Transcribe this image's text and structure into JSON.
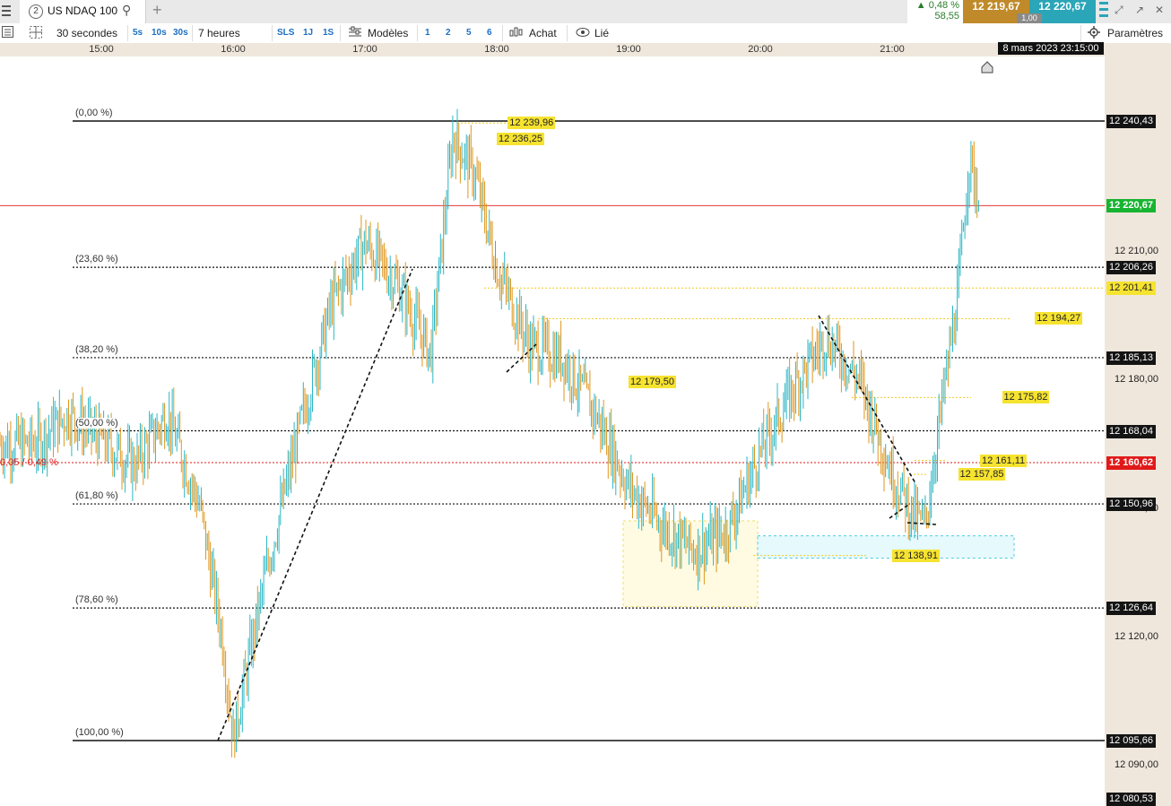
{
  "window": {
    "tab_number": "2",
    "instrument": "US NDAQ 100",
    "quote_change_pct": "0,48 %",
    "quote_change_pts": "58,55",
    "bid": "12 219,67",
    "ask": "12 220,67",
    "quantity": "1,00"
  },
  "toolbar": {
    "interval": "30 secondes",
    "quick_intervals": [
      "5s",
      "10s",
      "30s"
    ],
    "duration": "7 heures",
    "ranges": [
      "SLS",
      "1J",
      "1S"
    ],
    "templates_label": "Modèles",
    "layouts": [
      "1",
      "2",
      "5",
      "6"
    ],
    "buy_label": "Achat",
    "linked_label": "Lié",
    "settings_label": "Paramètres"
  },
  "time_axis": {
    "labels": [
      "15:00",
      "16:00",
      "17:00",
      "18:00",
      "19:00",
      "20:00",
      "21:00"
    ],
    "cursor_date": "8 mars 2023 23:15:00"
  },
  "colors": {
    "up": "#2bb6c4",
    "down": "#e0961c",
    "last_price": "#18b431",
    "alert_red": "#e01a1a",
    "level_yellow": "#f6e330",
    "axis_bg": "#efe7dc"
  },
  "chart_data": {
    "type": "line",
    "style": "candlestick",
    "instrument": "US NDAQ 100",
    "interval": "30s",
    "x_range": [
      "14:30",
      "21:45"
    ],
    "ylim": [
      12080,
      12250
    ],
    "series": [
      {
        "x": [
          "14:30",
          "14:45",
          "15:00",
          "15:15",
          "15:30",
          "15:45",
          "15:55",
          "16:00",
          "16:15",
          "16:30",
          "16:45",
          "17:00",
          "17:15",
          "17:30",
          "17:40",
          "17:50",
          "18:00",
          "18:15",
          "18:30",
          "18:45",
          "19:00",
          "19:15",
          "19:30",
          "19:45",
          "20:00",
          "20:15",
          "20:30",
          "20:45",
          "21:00",
          "21:10",
          "21:15",
          "21:20",
          "21:30",
          "21:35",
          "21:40"
        ],
        "values": [
          12165,
          12172,
          12166,
          12160,
          12172,
          12150,
          12120,
          12096,
          12135,
          12168,
          12198,
          12212,
          12202,
          12186,
          12237,
          12228,
          12206,
          12188,
          12185,
          12172,
          12155,
          12146,
          12140,
          12145,
          12163,
          12178,
          12190,
          12180,
          12158,
          12148,
          12146,
          12165,
          12200,
          12232,
          12221
        ]
      }
    ],
    "fibonacci": [
      {
        "label": "(0,00 %)",
        "price": 12240.43
      },
      {
        "label": "(23,60 %)",
        "price": 12206.26
      },
      {
        "label": "(38,20 %)",
        "price": 12185.13
      },
      {
        "label": "(50,00 %)",
        "price": 12168.04
      },
      {
        "label": "(61,80 %)",
        "price": 12150.96
      },
      {
        "label": "(78,60 %)",
        "price": 12126.64
      },
      {
        "label": "(100,00 %)",
        "price": 12095.66
      }
    ],
    "axis_tags": [
      {
        "text": "12 240,43",
        "style": "dark",
        "price": 12240.43
      },
      {
        "text": "12 220,67",
        "style": "green",
        "price": 12220.67
      },
      {
        "text": "12 210,00",
        "style": "plain",
        "price": 12210.0
      },
      {
        "text": "12 206,26",
        "style": "dark",
        "price": 12206.26
      },
      {
        "text": "12 201,41",
        "style": "yel",
        "price": 12201.41
      },
      {
        "text": "12 185,13",
        "style": "dark",
        "price": 12185.13
      },
      {
        "text": "12 180,00",
        "style": "plain",
        "price": 12180.0
      },
      {
        "text": "12 168,04",
        "style": "dark",
        "price": 12168.04
      },
      {
        "text": "12 160,62",
        "style": "red",
        "price": 12160.62
      },
      {
        "text": "12 150,00",
        "style": "plain",
        "price": 12150.0
      },
      {
        "text": "12 150,96",
        "style": "dark",
        "price": 12150.96
      },
      {
        "text": "12 126,64",
        "style": "dark",
        "price": 12126.64
      },
      {
        "text": "12 120,00",
        "style": "plain",
        "price": 12120.0
      },
      {
        "text": "12 095,66",
        "style": "dark",
        "price": 12095.66
      },
      {
        "text": "12 090,00",
        "style": "plain",
        "price": 12090.0
      },
      {
        "text": "12 080,53",
        "style": "dark",
        "price": 12080.53
      }
    ],
    "level_labels": [
      {
        "text": "12 239,96",
        "price": 12239.96,
        "time": "18:05"
      },
      {
        "text": "12 236,25",
        "price": 12236.25,
        "time": "18:00"
      },
      {
        "text": "12 194,27",
        "price": 12194.27,
        "time": "22:05"
      },
      {
        "text": "12 179,50",
        "price": 12179.5,
        "time": "19:00"
      },
      {
        "text": "12 175,82",
        "price": 12175.82,
        "time": "21:50"
      },
      {
        "text": "12 161,11",
        "price": 12161.11,
        "time": "21:40"
      },
      {
        "text": "12 157,85",
        "price": 12157.85,
        "time": "21:30"
      },
      {
        "text": "12 138,91",
        "price": 12138.91,
        "time": "21:00"
      }
    ],
    "alert_line": {
      "price": 12160.62,
      "label": "0,05 / 0,49 %"
    },
    "last_price": 12220.67
  }
}
